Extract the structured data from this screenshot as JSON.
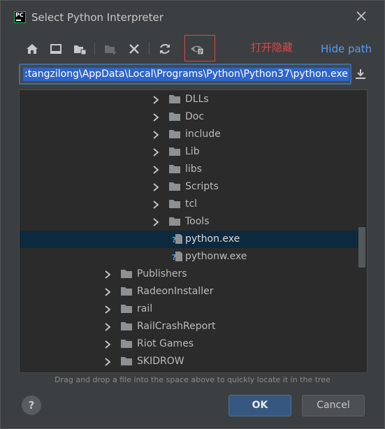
{
  "window": {
    "title": "Select Python Interpreter"
  },
  "toolbar": {
    "annotation": "打开隐藏",
    "hide_path_label": "Hide path",
    "icons": [
      "home-icon",
      "desktop-icon",
      "project-folder-icon",
      "new-folder-icon",
      "delete-icon",
      "refresh-icon",
      "show-hidden-icon"
    ]
  },
  "path": {
    "value": ":tangzilong\\AppData\\Local\\Programs\\Python\\Python37\\python.exe"
  },
  "tree": {
    "items": [
      {
        "label": "DLLs",
        "type": "folder",
        "level": 2
      },
      {
        "label": "Doc",
        "type": "folder",
        "level": 2
      },
      {
        "label": "include",
        "type": "folder",
        "level": 2
      },
      {
        "label": "Lib",
        "type": "folder",
        "level": 2
      },
      {
        "label": "libs",
        "type": "folder",
        "level": 2
      },
      {
        "label": "Scripts",
        "type": "folder",
        "level": 2
      },
      {
        "label": "tcl",
        "type": "folder",
        "level": 2
      },
      {
        "label": "Tools",
        "type": "folder",
        "level": 2
      },
      {
        "label": "python.exe",
        "type": "file",
        "level": 2,
        "selected": true
      },
      {
        "label": "pythonw.exe",
        "type": "file",
        "level": 2
      },
      {
        "label": "Publishers",
        "type": "folder",
        "level": 1
      },
      {
        "label": "RadeonInstaller",
        "type": "folder",
        "level": 1
      },
      {
        "label": "rail",
        "type": "folder",
        "level": 1
      },
      {
        "label": "RailCrashReport",
        "type": "folder",
        "level": 1
      },
      {
        "label": "Riot Games",
        "type": "folder",
        "level": 1
      },
      {
        "label": "SKIDROW",
        "type": "folder",
        "level": 1
      }
    ]
  },
  "hint": "Drag and drop a file into the space above to quickly locate it in the tree",
  "footer": {
    "help_label": "?",
    "ok_label": "OK",
    "cancel_label": "Cancel"
  },
  "colors": {
    "background": "#3c3f41",
    "tree_background": "#2b2b2b",
    "selection": "#0d293e",
    "accent_link": "#589df6",
    "annotation_red": "#e04545",
    "ok_button": "#365880"
  }
}
